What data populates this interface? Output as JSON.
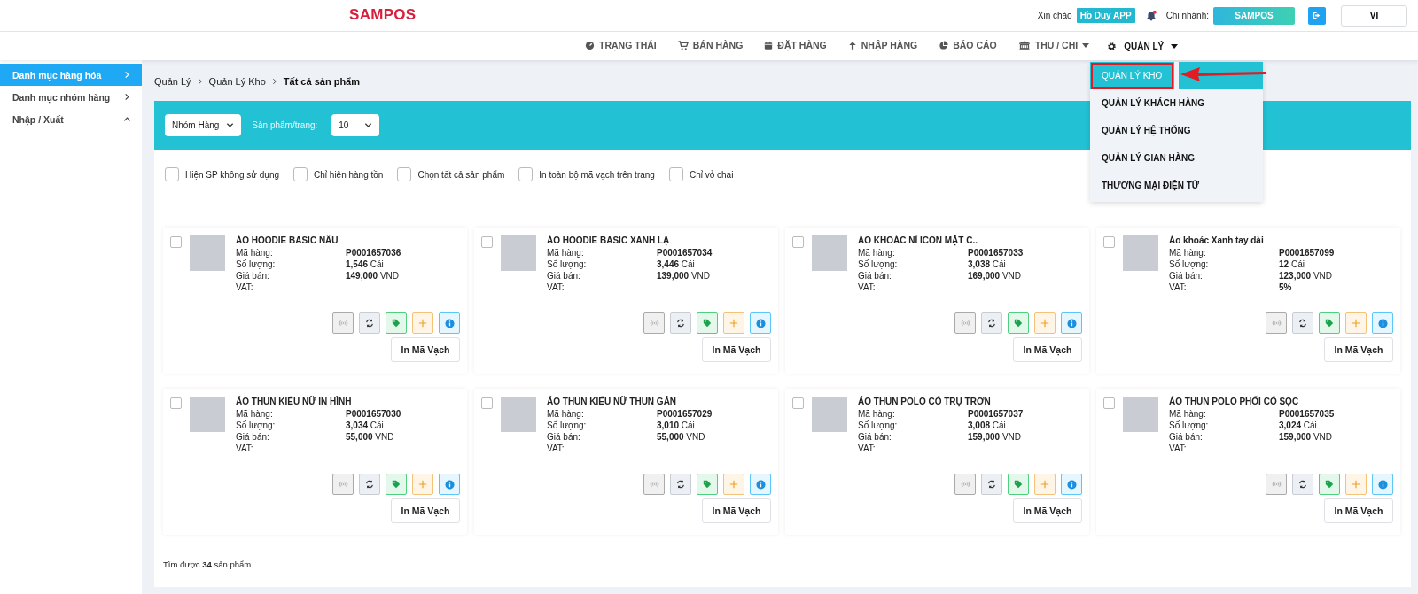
{
  "header": {
    "logo": "SAMPOS",
    "greeting": "Xin chào",
    "user": "Hồ Duy APP",
    "branch_label": "Chi nhánh:",
    "branch": "SAMPOS",
    "language": "VI",
    "has_notification": true
  },
  "nav": [
    {
      "label": "TRẠNG THÁI",
      "kind": "status",
      "selected": false,
      "dropdown": false
    },
    {
      "label": "BÁN HÀNG",
      "kind": "cart",
      "selected": false,
      "dropdown": false
    },
    {
      "label": "ĐẶT HÀNG",
      "kind": "calendar",
      "selected": false,
      "dropdown": false
    },
    {
      "label": "NHẬP HÀNG",
      "kind": "import",
      "selected": false,
      "dropdown": false
    },
    {
      "label": "BÁO CÁO",
      "kind": "report",
      "selected": false,
      "dropdown": false
    },
    {
      "label": "THU / CHI",
      "kind": "cash",
      "selected": false,
      "dropdown": true
    },
    {
      "label": "QUẢN LÝ",
      "kind": "settings",
      "selected": true,
      "dropdown": true
    }
  ],
  "menu": [
    {
      "label": "QUẢN LÝ KHO",
      "selected": true
    },
    {
      "label": "QUẢN LÝ KHÁCH HÀNG",
      "selected": false
    },
    {
      "label": "QUẢN LÝ HỆ THỐNG",
      "selected": false
    },
    {
      "label": "QUẢN LÝ GIAN HÀNG",
      "selected": false
    },
    {
      "label": "THƯƠNG MẠI ĐIỆN TỬ",
      "selected": false
    }
  ],
  "sidebar": {
    "items": [
      {
        "label": "Danh mục hàng hóa",
        "selected": true,
        "expanded": false
      },
      {
        "label": "Danh mục nhóm hàng",
        "selected": false,
        "expanded": false
      },
      {
        "label": "Nhập / Xuất",
        "selected": false,
        "expanded": true
      }
    ]
  },
  "breadcrumb": [
    "Quản Lý",
    "Quản Lý Kho",
    "Tất cả sản phẩm"
  ],
  "toolbar": {
    "group_select": "Nhóm Hàng",
    "per_page_label": "Sản phẩm/trang:",
    "per_page": "10"
  },
  "filters": [
    {
      "label": "Hiện SP không sử dụng",
      "checked": false
    },
    {
      "label": "Chỉ hiện hàng tồn",
      "checked": false
    },
    {
      "label": "Chọn tất cả sản phẩm",
      "checked": false
    },
    {
      "label": "In toàn bộ mã vạch trên trang",
      "checked": false
    },
    {
      "label": "Chỉ vỏ chai",
      "checked": false
    }
  ],
  "products": [
    {
      "name": "ÁO HOODIE BASIC NÂU",
      "labels": [
        "Mã hàng:",
        "Số lượng:",
        "Giá bán:",
        "VAT:"
      ],
      "code": "P0001657036",
      "quantity": "**1,546** Cái",
      "price": "**149,000** VND",
      "checked": false,
      "print_label": "In Mã Vạch"
    },
    {
      "name": "ÁO HOODIE BASIC XANH LẠ",
      "labels": [
        "Mã hàng:",
        "Số lượng:",
        "Giá bán:",
        "VAT:"
      ],
      "code": "P0001657034",
      "quantity": "**3,446** Cái",
      "price": "**139,000** VND",
      "checked": false,
      "print_label": "In Mã Vạch"
    },
    {
      "name": "ÁO KHOÁC NỈ ICON MẶT C..",
      "labels": [
        "Mã hàng:",
        "Số lượng:",
        "Giá bán:",
        "VAT:"
      ],
      "code": "P0001657033",
      "quantity": "**3,038** Cái",
      "price": "**169,000** VND",
      "checked": false,
      "print_label": "In Mã Vạch"
    },
    {
      "name": "Áo khoác Xanh tay dài",
      "labels": [
        "Mã hàng:",
        "Số lượng:",
        "Giá bán:",
        "VAT:"
      ],
      "code": "P0001657099",
      "quantity": "**12** Cái",
      "price": "**123,000** VND",
      "vat": "5%",
      "checked": false,
      "print_label": "In Mã Vạch"
    },
    {
      "name": "ÁO THUN KIỂU NỮ IN HÌNH",
      "labels": [
        "Mã hàng:",
        "Số lượng:",
        "Giá bán:",
        "VAT:"
      ],
      "code": "P0001657030",
      "quantity": "**3,034** Cái",
      "price": "**55,000** VND",
      "checked": false,
      "print_label": "In Mã Vạch"
    },
    {
      "name": "ÁO THUN KIỂU NỮ THUN GÂN",
      "labels": [
        "Mã hàng:",
        "Số lượng:",
        "Giá bán:",
        "VAT:"
      ],
      "code": "P0001657029",
      "quantity": "**3,010** Cái",
      "price": "**55,000** VND",
      "checked": false,
      "print_label": "In Mã Vạch"
    },
    {
      "name": "ÁO THUN POLO CÓ TRỤ TRƠN",
      "labels": [
        "Mã hàng:",
        "Số lượng:",
        "Giá bán:",
        "VAT:"
      ],
      "code": "P0001657037",
      "quantity": "**3,008** Cái",
      "price": "**159,000** VND",
      "checked": false,
      "print_label": "In Mã Vạch"
    },
    {
      "name": "ÁO THUN POLO PHỐI CÓ SỌC",
      "labels": [
        "Mã hàng:",
        "Số lượng:",
        "Giá bán:",
        "VAT:"
      ],
      "code": "P0001657035",
      "quantity": "**3,024** Cái",
      "price": "**159,000** VND",
      "checked": false,
      "print_label": "In Mã Vạch"
    }
  ],
  "footer": "Tìm được **34** sản phẩm"
}
